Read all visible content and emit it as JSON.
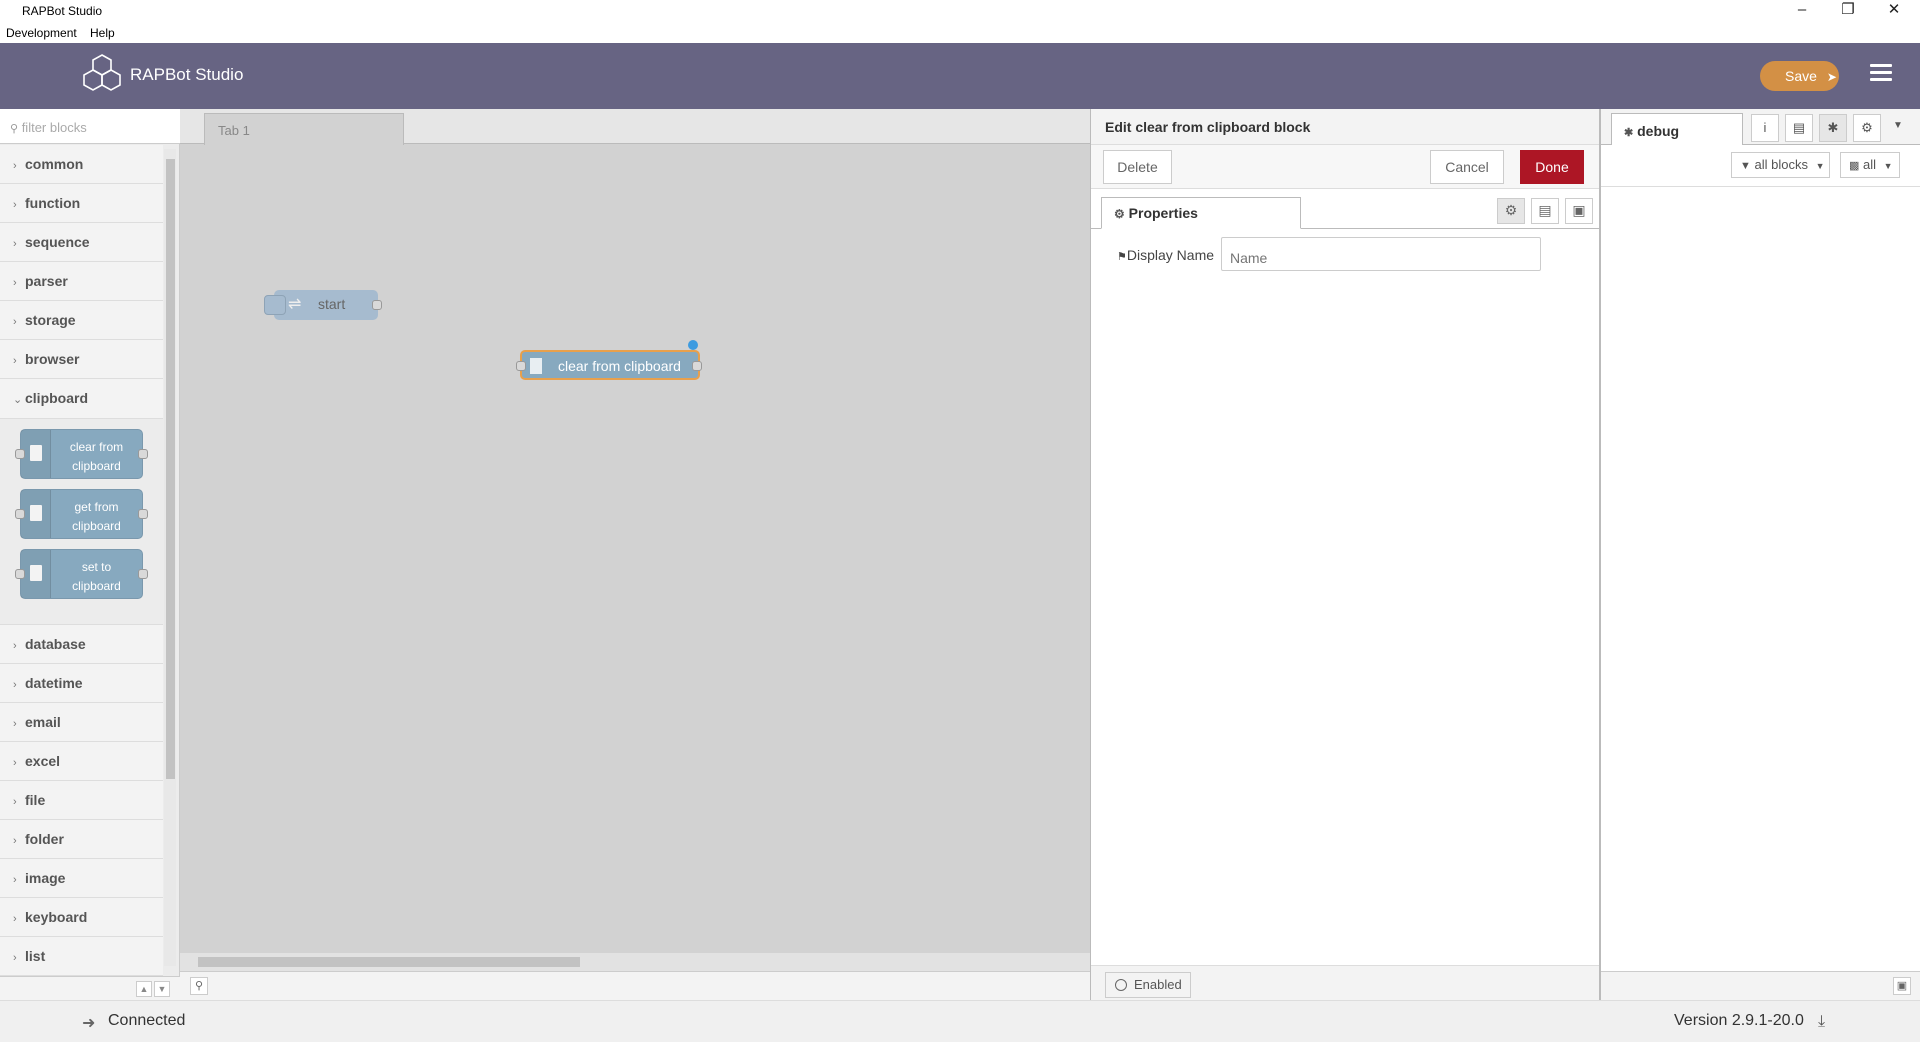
{
  "window": {
    "title": "RAPBot Studio",
    "controls": [
      "minimize",
      "restore",
      "close"
    ]
  },
  "menubar": {
    "items": [
      "Development",
      "Help"
    ]
  },
  "header": {
    "logo_text": "RAPBot Studio",
    "save_label": "Save",
    "colors": {
      "bar": "#676483",
      "save": "#d39045"
    }
  },
  "palette": {
    "filter_placeholder": "filter blocks",
    "categories_before": [
      "common",
      "function",
      "sequence",
      "parser",
      "storage",
      "browser"
    ],
    "open_category": "clipboard",
    "open_nodes": [
      {
        "label1": "clear from",
        "label2": "clipboard"
      },
      {
        "label1": "get from",
        "label2": "clipboard"
      },
      {
        "label1": "set to",
        "label2": "clipboard"
      }
    ],
    "categories_after": [
      "database",
      "datetime",
      "email",
      "excel",
      "file",
      "folder",
      "image",
      "keyboard",
      "list"
    ]
  },
  "workspace": {
    "tab_label": "Tab 1",
    "nodes": {
      "start": "start",
      "clear": "clear from clipboard"
    },
    "node_color": "#87a9bf",
    "selected_outline": "#e8a04c"
  },
  "editor": {
    "title": "Edit clear from clipboard block",
    "delete_label": "Delete",
    "cancel_label": "Cancel",
    "done_label": "Done",
    "tab_label": "Properties",
    "field_label": "Display Name",
    "field_placeholder": "Name",
    "field_value": "",
    "enabled_label": "Enabled",
    "done_color": "#ad1625"
  },
  "sidebar": {
    "tab_label": "debug",
    "filter_label": "all blocks",
    "clear_label": "all"
  },
  "status": {
    "connection": "Connected",
    "version": "Version 2.9.1-20.0"
  }
}
